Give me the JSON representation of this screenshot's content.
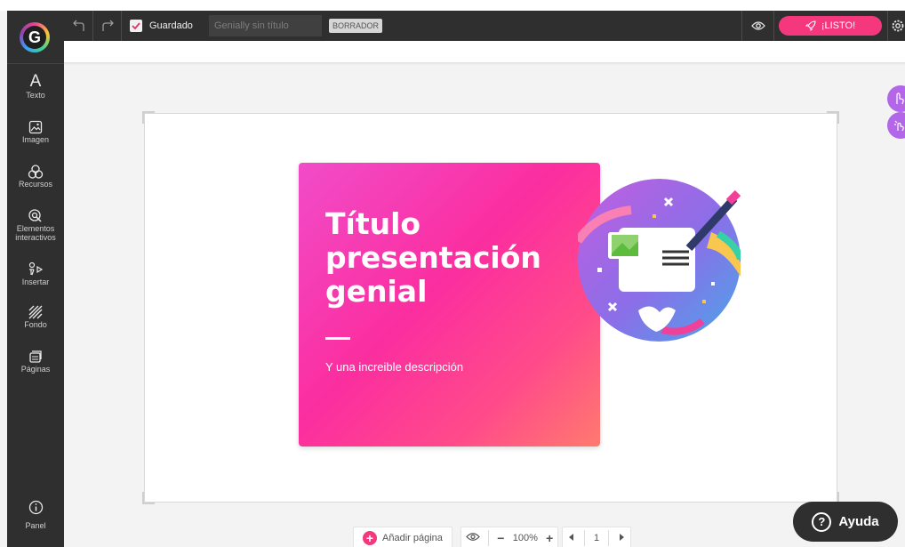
{
  "toolbar": {
    "saved_label": "Guardado",
    "title_placeholder": "Genially sin título",
    "draft_badge": "BORRADOR",
    "ready_label": "¡LISTO!"
  },
  "sidebar": {
    "logo": "G",
    "items": [
      {
        "label": "Texto",
        "icon": "text-icon"
      },
      {
        "label": "Imagen",
        "icon": "image-icon"
      },
      {
        "label": "Recursos",
        "icon": "resources-icon"
      },
      {
        "label": "Elementos interactivos",
        "icon": "interactive-icon"
      },
      {
        "label": "Insertar",
        "icon": "insert-icon"
      },
      {
        "label": "Fondo",
        "icon": "background-icon"
      },
      {
        "label": "Páginas",
        "icon": "pages-icon"
      },
      {
        "label": "Panel",
        "icon": "info-icon"
      }
    ]
  },
  "slide": {
    "title": "Título\npresentación\ngenial",
    "description": "Y una increible descripción"
  },
  "bottom": {
    "add_page": "Añadir página",
    "zoom_minus": "−",
    "zoom_level": "100%",
    "zoom_plus": "+",
    "page_number": "1"
  },
  "help": {
    "label": "Ayuda"
  },
  "colors": {
    "accent": "#f5377d",
    "sidebar": "#2f2f2f",
    "float": "#b466e8"
  }
}
